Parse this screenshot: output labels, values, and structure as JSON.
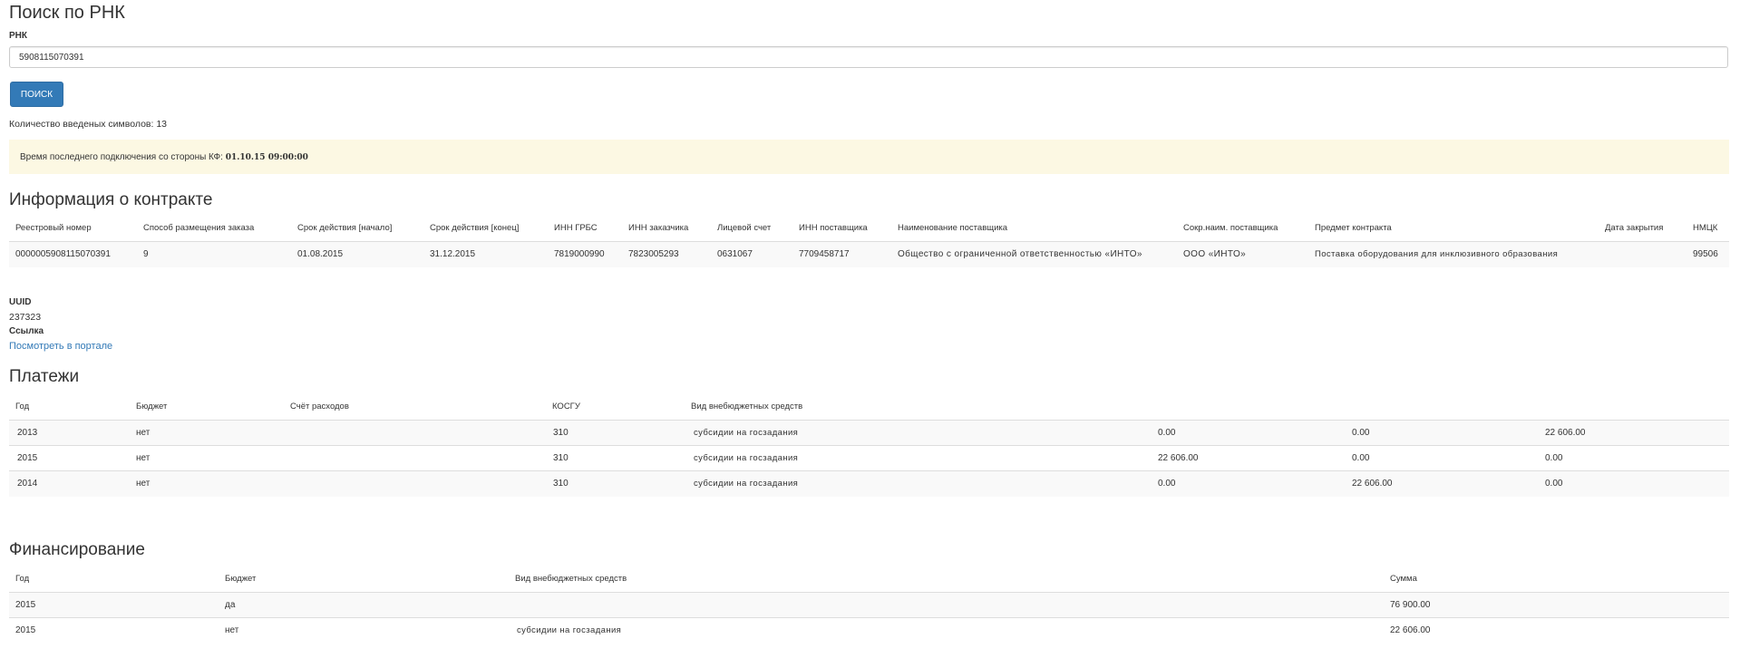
{
  "page_title": "Поиск по РНК",
  "search": {
    "label": "РНК",
    "value": "5908115070391",
    "button": "ПОИСК",
    "char_count": "Количество введеных символов: 13"
  },
  "alert": {
    "text": "Время последнего подключения со стороны КФ: ",
    "datetime": "01.10.15 09:00:00"
  },
  "contract": {
    "title": "Информация о контракте",
    "headers": [
      "Реестровый номер",
      "Способ размещения заказа",
      "Срок действия [начало]",
      "Срок действия [конец]",
      "ИНН ГРБС",
      "ИНН заказчика",
      "Лицевой счет",
      "ИНН поставщика",
      "Наименование поставщика",
      "Сокр.наим. поставщика",
      "Предмет контракта",
      "Дата закрытия",
      "НМЦК"
    ],
    "rows": [
      [
        "0000005908115070391",
        "9",
        "01.08.2015",
        "31.12.2015",
        "7819000990",
        "7823005293",
        "0631067",
        "7709458717",
        "Общество с ограниченной ответственностью «ИНТО»",
        "ООО «ИНТО»",
        "Поставка оборудования для инклюзивного образования",
        "",
        "99506"
      ]
    ]
  },
  "meta": {
    "uuid_label": "UUID",
    "uuid_value": "237323",
    "link_label": "Ссылка",
    "link_text": "Посмотреть в портале"
  },
  "payments": {
    "title": "Платежи",
    "headers": [
      "Год",
      "Бюджет",
      "Счёт расходов",
      "КОСГУ",
      "Вид внебюджетных средств",
      "",
      "",
      ""
    ],
    "rows": [
      [
        "2013",
        "нет",
        "",
        "310",
        "субсидии на госзадания",
        "0.00",
        "0.00",
        "22 606.00"
      ],
      [
        "2015",
        "нет",
        "",
        "310",
        "субсидии на госзадания",
        "22 606.00",
        "0.00",
        "0.00"
      ],
      [
        "2014",
        "нет",
        "",
        "310",
        "субсидии на госзадания",
        "0.00",
        "22 606.00",
        "0.00"
      ]
    ]
  },
  "financing": {
    "title": "Финансирование",
    "headers": [
      "Год",
      "Бюджет",
      "Вид внебюджетных средств",
      "Сумма"
    ],
    "rows": [
      [
        "2015",
        "да",
        "",
        "76 900.00"
      ],
      [
        "2015",
        "нет",
        "субсидии на госзадания",
        "22 606.00"
      ]
    ]
  },
  "colors": {
    "primary_button": "#337ab7",
    "alert_bg": "#fcf8e3",
    "stripe_bg": "#f9f9f9"
  }
}
